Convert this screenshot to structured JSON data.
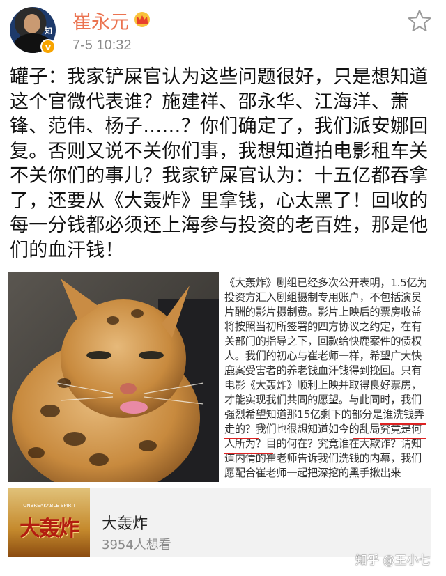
{
  "post": {
    "author": "崔永元",
    "time": "7-5 10:32",
    "verified_badge": "v",
    "avatar_watermark": "知",
    "text": "罐子：我家铲屎官认为这些问题很好，只是想知道这个官微代表谁？施建祥、邵永华、江海洋、萧锋、范伟、杨子……？你们确定了，我们派安娜回复。否则又说不关你们事，我想知道拍电影租车关不关你们的事儿？我家铲屎官认为：十五亿都吞拿了，还要从《大轰炸》里拿钱，心太黑了！回收的每一分钱都必须还上海参与投资的老百姓，那是他们的血汗钱！"
  },
  "images": {
    "screenshot_text": "《大轰炸》剧组已经多次公开表明，1.5亿为投资方汇入剧组摄制专用账户，不包括演员片酬的影片摄制费。影片上映后的票房收益将按照当初所签署的四方协议之约定，在有关部门的指导之下，回款给快鹿案件的债权人。我们的初心与崔老师一样，希望广大快鹿案受害者的养老钱血汗钱得到挽回。只有电影《大轰炸》顺利上映并取得良好票房，才能实现我们共同的愿望。与此同时，我们强烈希望知道那15亿剩下的部分是谁洗钱弄走的？我们也很想知道如今的乱局究竟是何人所为？目的何在？究竟谁在大欺诈？请知道内情的崔老师告诉我们洗钱的内幕，我们愿配合崔老师一起把深挖的黑手揪出来"
  },
  "card": {
    "poster_subtitle": "UNBREAKABLE SPIRIT",
    "poster_title": "大轰炸",
    "title": "大轰炸",
    "subtitle": "3954人想看"
  },
  "watermark": "知乎 @王小七",
  "colors": {
    "username": "#eb7350",
    "vip_badge": "#f7a400",
    "underline": "#dd2222"
  },
  "icons": [
    "crown-icon",
    "star-icon",
    "verified-badge-icon"
  ]
}
